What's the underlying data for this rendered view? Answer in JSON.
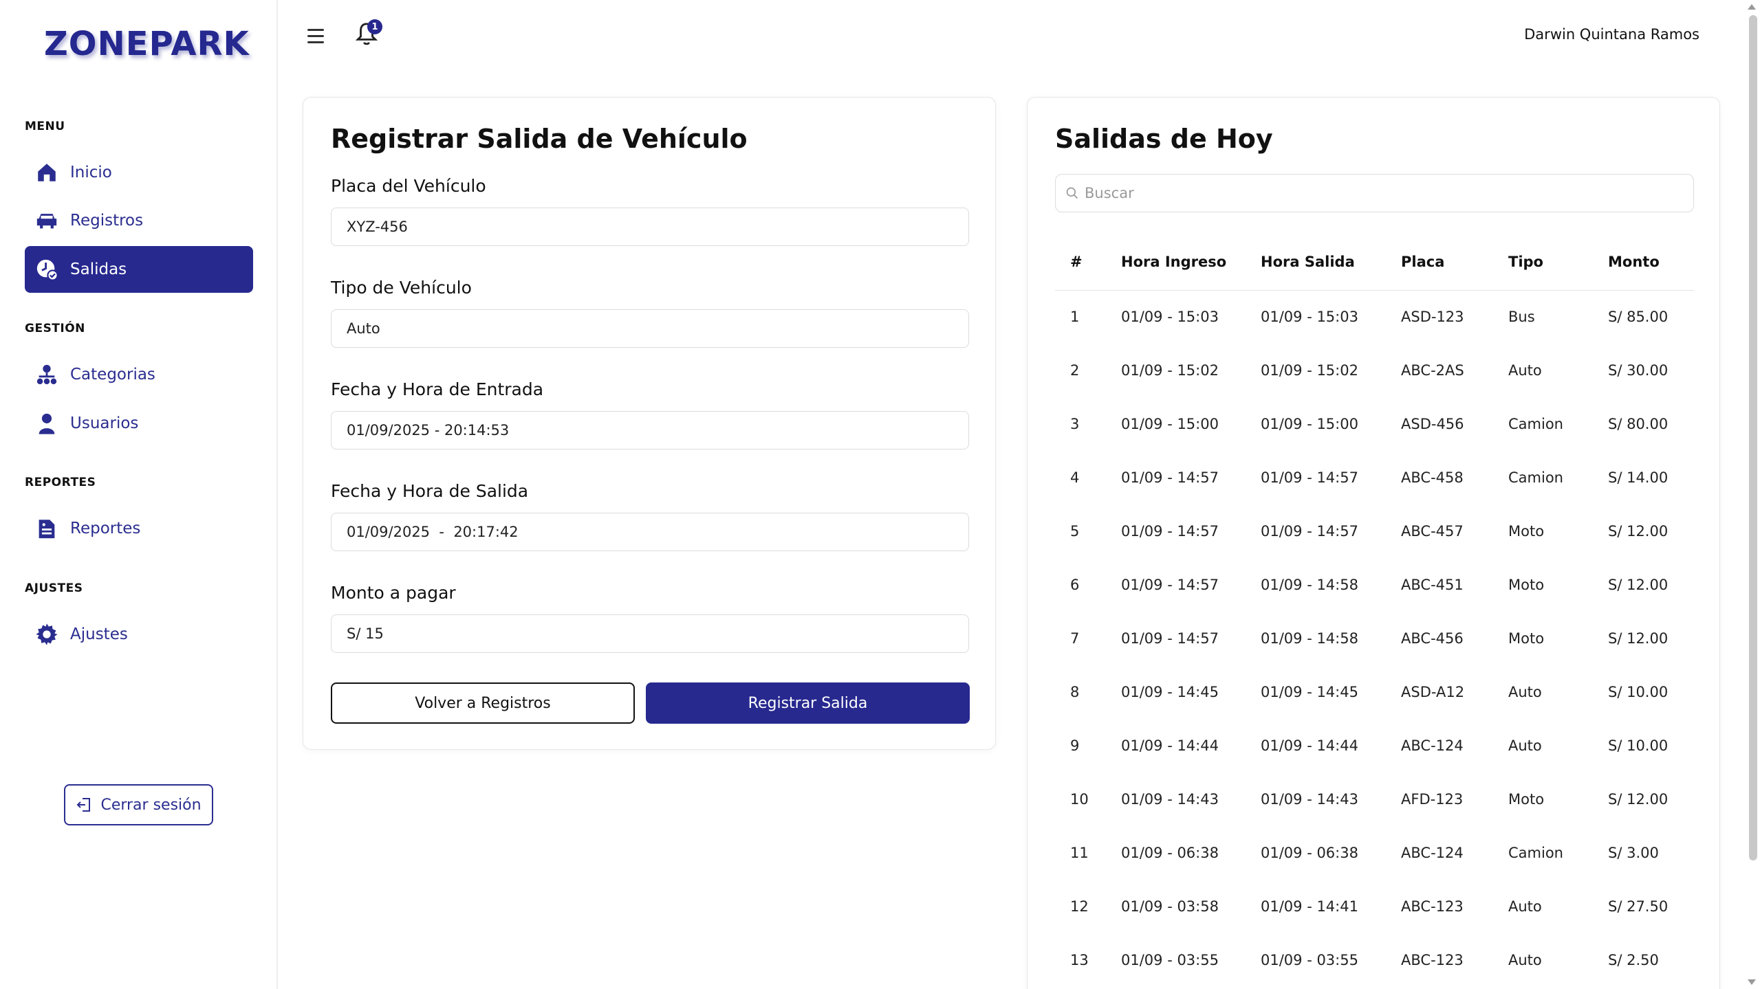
{
  "app": {
    "logo": "ZONEPARK",
    "user_name": "Darwin Quintana Ramos",
    "notification_count": "1"
  },
  "sidebar": {
    "sections": [
      {
        "title": "MENU",
        "items": [
          {
            "label": "Inicio",
            "icon": "home-icon"
          },
          {
            "label": "Registros",
            "icon": "car-icon"
          },
          {
            "label": "Salidas",
            "icon": "clock-check-icon",
            "active": true
          }
        ]
      },
      {
        "title": "GESTIÓN",
        "items": [
          {
            "label": "Categorias",
            "icon": "hierarchy-icon"
          },
          {
            "label": "Usuarios",
            "icon": "user-icon"
          }
        ]
      },
      {
        "title": "REPORTES",
        "items": [
          {
            "label": "Reportes",
            "icon": "report-icon"
          }
        ]
      },
      {
        "title": "AJUSTES",
        "items": [
          {
            "label": "Ajustes",
            "icon": "gear-icon"
          }
        ]
      }
    ],
    "logout_label": "Cerrar sesión"
  },
  "form": {
    "title": "Registrar Salida de Vehículo",
    "fields": [
      {
        "label": "Placa del Vehículo",
        "value": "XYZ-456"
      },
      {
        "label": "Tipo de Vehículo",
        "value": "Auto"
      },
      {
        "label": "Fecha y Hora de Entrada",
        "value": "01/09/2025 - 20:14:53"
      },
      {
        "label": "Fecha y Hora de Salida",
        "value": "01/09/2025  -  20:17:42"
      },
      {
        "label": "Monto a pagar",
        "value": "S/ 15"
      }
    ],
    "back_button": "Volver a Registros",
    "submit_button": "Registrar Salida"
  },
  "exits": {
    "title": "Salidas de Hoy",
    "search_placeholder": "Buscar",
    "columns": [
      "#",
      "Hora Ingreso",
      "Hora Salida",
      "Placa",
      "Tipo",
      "Monto"
    ],
    "rows": [
      [
        "1",
        "01/09 - 15:03",
        "01/09 - 15:03",
        "ASD-123",
        "Bus",
        "S/ 85.00"
      ],
      [
        "2",
        "01/09 - 15:02",
        "01/09 - 15:02",
        "ABC-2AS",
        "Auto",
        "S/ 30.00"
      ],
      [
        "3",
        "01/09 - 15:00",
        "01/09 - 15:00",
        "ASD-456",
        "Camion",
        "S/ 80.00"
      ],
      [
        "4",
        "01/09 - 14:57",
        "01/09 - 14:57",
        "ABC-458",
        "Camion",
        "S/ 14.00"
      ],
      [
        "5",
        "01/09 - 14:57",
        "01/09 - 14:57",
        "ABC-457",
        "Moto",
        "S/ 12.00"
      ],
      [
        "6",
        "01/09 - 14:57",
        "01/09 - 14:58",
        "ABC-451",
        "Moto",
        "S/ 12.00"
      ],
      [
        "7",
        "01/09 - 14:57",
        "01/09 - 14:58",
        "ABC-456",
        "Moto",
        "S/ 12.00"
      ],
      [
        "8",
        "01/09 - 14:45",
        "01/09 - 14:45",
        "ASD-A12",
        "Auto",
        "S/ 10.00"
      ],
      [
        "9",
        "01/09 - 14:44",
        "01/09 - 14:44",
        "ABC-124",
        "Auto",
        "S/ 10.00"
      ],
      [
        "10",
        "01/09 - 14:43",
        "01/09 - 14:43",
        "AFD-123",
        "Moto",
        "S/ 12.00"
      ],
      [
        "11",
        "01/09 - 06:38",
        "01/09 - 06:38",
        "ABC-124",
        "Camion",
        "S/ 3.00"
      ],
      [
        "12",
        "01/09 - 03:58",
        "01/09 - 14:41",
        "ABC-123",
        "Auto",
        "S/ 27.50"
      ],
      [
        "13",
        "01/09 - 03:55",
        "01/09 - 03:55",
        "ABC-123",
        "Auto",
        "S/ 2.50"
      ]
    ]
  },
  "colors": {
    "primary": "#27298f",
    "border": "#dcdcdc"
  }
}
